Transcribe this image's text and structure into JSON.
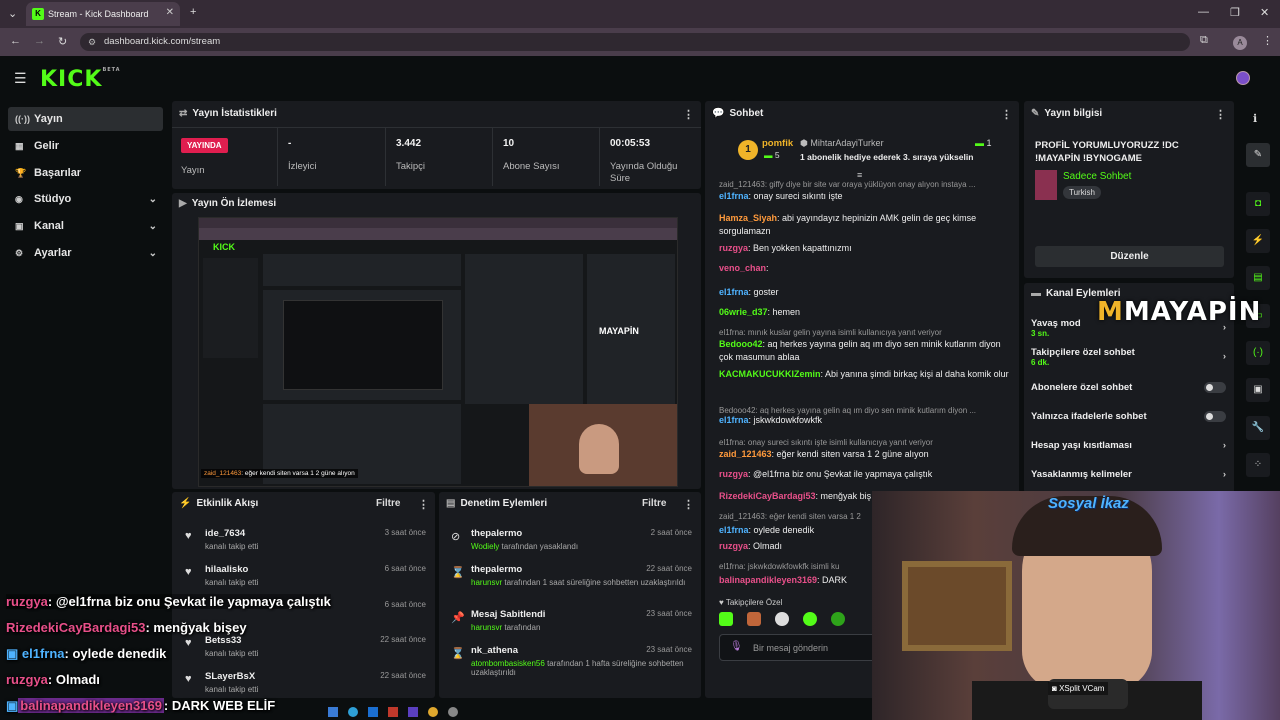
{
  "browser": {
    "tab_title": "Stream - Kick Dashboard",
    "url": "dashboard.kick.com/stream",
    "avatar": "A"
  },
  "brand": {
    "logo": "KICK",
    "beta": "BETA"
  },
  "nav": [
    {
      "label": "Yayın",
      "icon": "radio-icon"
    },
    {
      "label": "Gelir",
      "icon": "cash-icon"
    },
    {
      "label": "Başarılar",
      "icon": "trophy-icon"
    },
    {
      "label": "Stüdyo",
      "icon": "studio-icon"
    },
    {
      "label": "Kanal",
      "icon": "channel-icon"
    },
    {
      "label": "Ayarlar",
      "icon": "gear-icon"
    }
  ],
  "stats": {
    "title": "Yayın İstatistikleri",
    "live_badge": "YAYINDA",
    "live_label": "Yayın",
    "items": [
      {
        "value": "-",
        "label": "İzleyici"
      },
      {
        "value": "3.442",
        "label": "Takipçi"
      },
      {
        "value": "10",
        "label": "Abone Sayısı"
      },
      {
        "value": "00:05:53",
        "label": "Yayında Olduğu Süre"
      }
    ]
  },
  "preview": {
    "title": "Yayın Ön İzlemesi",
    "caption_user": "zaid_121463",
    "caption_text": ": eğer kendi siten varsa 1 2 güne alıyon"
  },
  "activity": {
    "title": "Etkinlik Akışı",
    "filter": "Filtre",
    "rows": [
      {
        "name": "ide_7634",
        "sub": "kanalı takip etti",
        "time": "3 saat önce"
      },
      {
        "name": "hilaalisko",
        "sub": "kanalı takip etti",
        "time": "6 saat önce"
      },
      {
        "name": "",
        "sub": "",
        "time": "6 saat önce"
      },
      {
        "name": "Betss33",
        "sub": "kanalı takip etti",
        "time": "22 saat önce"
      },
      {
        "name": "SLayerBsX",
        "sub": "kanalı takip etti",
        "time": "22 saat önce"
      }
    ]
  },
  "moderation": {
    "title": "Denetim Eylemleri",
    "filter": "Filtre",
    "rows": [
      {
        "name": "thepalermo",
        "by": "Wodiely",
        "sub": "tarafından yasaklandı",
        "time": "2 saat önce"
      },
      {
        "name": "thepalermo",
        "by": "harunsvr",
        "sub": "tarafından 1 saat süreliğine sohbetten uzaklaştırıldı",
        "time": "22 saat önce"
      },
      {
        "name": "Mesaj Sabitlendi",
        "by": "harunsvr",
        "sub": "tarafından",
        "time": "23 saat önce"
      },
      {
        "name": "nk_athena",
        "by": "atombombasisken56",
        "sub": "tarafından 1 hafta süreliğine sohbetten uzaklaştırıldı",
        "time": "23 saat önce"
      }
    ]
  },
  "chat": {
    "title": "Sohbet",
    "pinned_user": "pomfik",
    "pinned_count": "5",
    "gifter": "MihtarAdayiTurker",
    "gift_text": "1 abonelik hediye ederek 3. sıraya yükselin",
    "gift_count": "1",
    "followers_only": "Takipçilere Özel",
    "input_placeholder": "Bir mesaj gönderin",
    "messages": [
      {
        "user": "",
        "text": "zaid_121463: giffy diye bir site var oraya yüklüyon onay alıyon instaya ...",
        "color": "#999"
      },
      {
        "user": "el1frna",
        "text": ": onay sureci sıkıntı işte",
        "color": "#4fb3ff"
      },
      {
        "user": "Hamza_Siyah",
        "text": ": abi yayındayız hepinizin AMK gelin de geç kimse sorgulamazn",
        "color": "#ff9a3c"
      },
      {
        "user": "ruzgya",
        "text": ": Ben yokken kapattınızmı",
        "color": "#e8508a"
      },
      {
        "user": "veno_chan",
        "text": ":",
        "color": "#e8508a"
      },
      {
        "user": "el1frna",
        "text": ": goster",
        "color": "#4fb3ff"
      },
      {
        "user": "06wrie_d37",
        "text": ": hemen",
        "color": "#53fc18"
      },
      {
        "user": "",
        "text": "el1frna: mınık kuslar gelin yayına isimli kullanıcıya yanıt veriyor",
        "color": "#999"
      },
      {
        "user": "Bedooo42",
        "text": ": aq herkes yayına gelin aq ım diyo sen minik kutlarım diyon çok masumun ablaa",
        "color": "#53fc18"
      },
      {
        "user": "KACMAKUCUKKIZemin",
        "text": ": Abi yanına şimdi birkaç kişi al daha komik olur",
        "color": "#53fc18"
      },
      {
        "user": "",
        "text": "Bedooo42: aq herkes yayına gelin aq ım diyo sen minik kutlarım diyon ...",
        "color": "#999"
      },
      {
        "user": "el1frna",
        "text": ": jskwkdowkfowkfk",
        "color": "#4fb3ff"
      },
      {
        "user": "",
        "text": "el1frna: onay sureci sıkıntı işte isimli kullanıcıya yanıt veriyor",
        "color": "#999"
      },
      {
        "user": "zaid_121463",
        "text": ": eğer kendi siten varsa 1 2 güne alıyon",
        "color": "#ff9a3c"
      },
      {
        "user": "ruzgya",
        "text": ": @el1frna biz onu Şevkat ile yapmaya çalıştık",
        "color": "#e8508a"
      },
      {
        "user": "RizedekiCayBardagi53",
        "text": ": menğyak biş",
        "color": "#e8508a"
      },
      {
        "user": "",
        "text": "zaid_121463: eğer kendi siten varsa 1 2",
        "color": "#999"
      },
      {
        "user": "el1frna",
        "text": ": oylede denedik",
        "color": "#4fb3ff"
      },
      {
        "user": "ruzgya",
        "text": ": Olmadı",
        "color": "#e8508a"
      },
      {
        "user": "",
        "text": "el1frna: jskwkdowkfowkfk isimli ku",
        "color": "#999"
      },
      {
        "user": "balinapandikleyen3169",
        "text": ": DARK",
        "color": "#e8508a"
      }
    ]
  },
  "info": {
    "title": "Yayın bilgisi",
    "stream_title": "PROFİL YORUMLUYORUZZ !DC !MAYAPİN !BYNOGAME",
    "category": "Sadece Sohbet",
    "tag": "Turkish",
    "edit": "Düzenle"
  },
  "actions": {
    "title": "Kanal Eylemleri",
    "items": [
      {
        "label": "Yavaş mod",
        "sub": "3 sn.",
        "kind": "chev"
      },
      {
        "label": "Takipçilere özel sohbet",
        "sub": "6 dk.",
        "kind": "chev"
      },
      {
        "label": "Abonelere özel sohbet",
        "sub": "",
        "kind": "toggle"
      },
      {
        "label": "Yalnızca ifadelerle sohbet",
        "sub": "",
        "kind": "toggle"
      },
      {
        "label": "Hesap yaşı kısıtlaması",
        "sub": "",
        "kind": "chev"
      },
      {
        "label": "Yasaklanmış kelimeler",
        "sub": "",
        "kind": "chev"
      }
    ]
  },
  "overlay": {
    "brand": "MAYAPİN",
    "social": "Sosyal İkaz",
    "vcam": "XSplit VCam",
    "lines": [
      {
        "user": "ruzgya",
        "text": ": @el1frna biz onu Şevkat ile yapmaya çalıştık",
        "color": "#e8508a"
      },
      {
        "user": "RizedekiCayBardagi53",
        "text": ": menğyak bişey",
        "color": "#e8508a"
      },
      {
        "user": "el1frna",
        "text": ": oylede denedik",
        "color": "#4fb3ff"
      },
      {
        "user": "ruzgya",
        "text": ": Olmadı",
        "color": "#e8508a"
      },
      {
        "user": "balinapandikleyen3169",
        "text": ": DARK WEB ELİF",
        "color": "#e8508a"
      }
    ]
  }
}
